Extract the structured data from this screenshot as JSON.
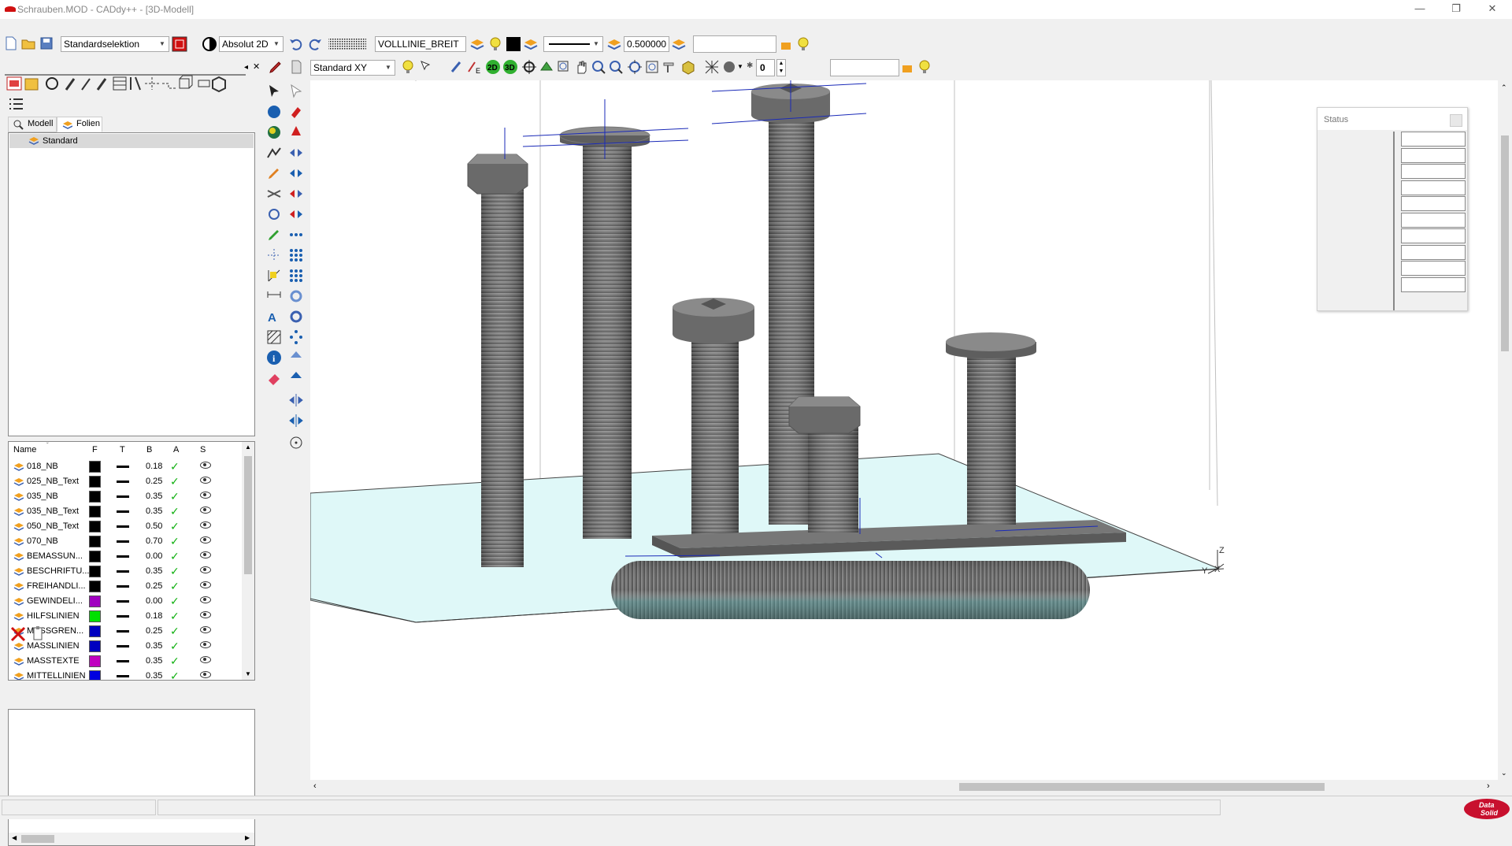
{
  "window": {
    "title": "Schrauben.MOD  -  CADdy++ - [3D-Modell]",
    "controls": [
      "minimize",
      "restore",
      "close"
    ]
  },
  "toolbar1": {
    "selection_mode": "Standardselektion",
    "coord_mode": "Absolut 2D",
    "linetype": "VOLLLINIE_BREIT",
    "line_width": "0.500000",
    "layer_field": ""
  },
  "toolbar2": {
    "view": "Standard XY",
    "step_value": "0",
    "search_field": ""
  },
  "left_panel": {
    "tabs": [
      {
        "label": "Modell",
        "active": false
      },
      {
        "label": "Folien",
        "active": true
      }
    ],
    "folie_selected": "Standard",
    "layer_headers": [
      "Name",
      "F",
      "T",
      "B",
      "A",
      "S"
    ],
    "layers": [
      {
        "name": "018_NB",
        "color": "#000000",
        "width": "0.18"
      },
      {
        "name": "025_NB_Text",
        "color": "#000000",
        "width": "0.25"
      },
      {
        "name": "035_NB",
        "color": "#000000",
        "width": "0.35"
      },
      {
        "name": "035_NB_Text",
        "color": "#000000",
        "width": "0.35"
      },
      {
        "name": "050_NB_Text",
        "color": "#000000",
        "width": "0.50"
      },
      {
        "name": "070_NB",
        "color": "#000000",
        "width": "0.70"
      },
      {
        "name": "BEMASSUN...",
        "color": "#000000",
        "width": "0.00"
      },
      {
        "name": "BESCHRIFTU...",
        "color": "#000000",
        "width": "0.35"
      },
      {
        "name": "FREIHANDLI...",
        "color": "#000000",
        "width": "0.25"
      },
      {
        "name": "GEWINDELI...",
        "color": "#a000c0",
        "width": "0.00"
      },
      {
        "name": "HILFSLINIEN",
        "color": "#00e000",
        "width": "0.18"
      },
      {
        "name": "MASSGREN...",
        "color": "#0000c0",
        "width": "0.25"
      },
      {
        "name": "MASSLINIEN",
        "color": "#0000c0",
        "width": "0.35"
      },
      {
        "name": "MASSTEXTE",
        "color": "#c000c0",
        "width": "0.35"
      },
      {
        "name": "MITTELLINIEN",
        "color": "#0000e0",
        "width": "0.35"
      }
    ]
  },
  "status_window": {
    "title": "Status"
  },
  "axis_labels": {
    "z": "Z",
    "y": "Y",
    "x": "X"
  },
  "brand": {
    "line1": "Data",
    "line2": "Solid",
    "color": "#c8102e"
  },
  "colors": {
    "ground": "#dff8f8",
    "bolt": "#6f6f6f",
    "axis": "#1a2ab8"
  }
}
